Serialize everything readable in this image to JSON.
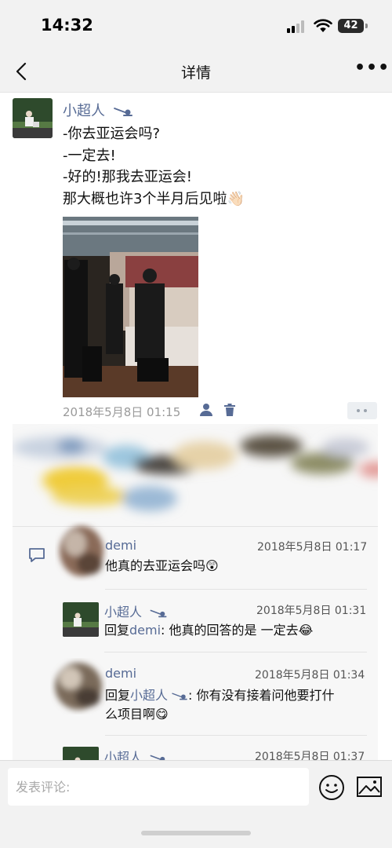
{
  "status_bar": {
    "time": "14:32",
    "battery": "42"
  },
  "nav": {
    "title": "详情"
  },
  "post": {
    "author": "小超人",
    "lines": [
      "-你去亚运会吗?",
      "-一定去!",
      "-好的!那我去亚运会!",
      "那大概也许3个半月后见啦👋🏻"
    ],
    "time": "2018年5月8日 01:15"
  },
  "comments": [
    {
      "name": "demi",
      "time": "2018年5月8日 01:17",
      "text": "他真的去亚运会吗😲"
    },
    {
      "name": "小超人",
      "time": "2018年5月8日 01:31",
      "prefix": "回复",
      "reply_to": "demi",
      "text": ": 他真的回答的是 一定去😂"
    },
    {
      "name": "demi",
      "time": "2018年5月8日 01:34",
      "prefix": "回复",
      "reply_to": "小超人",
      "text": ": 你有没有接着问他要打什",
      "text2": "么项目啊😋"
    },
    {
      "name": "小超人",
      "time": "2018年5月8日 01:37"
    }
  ],
  "input": {
    "placeholder": "发表评论:"
  },
  "colors": {
    "link": "#576b95",
    "background": "#f2f2f2",
    "panel": "#f7f7f7"
  }
}
